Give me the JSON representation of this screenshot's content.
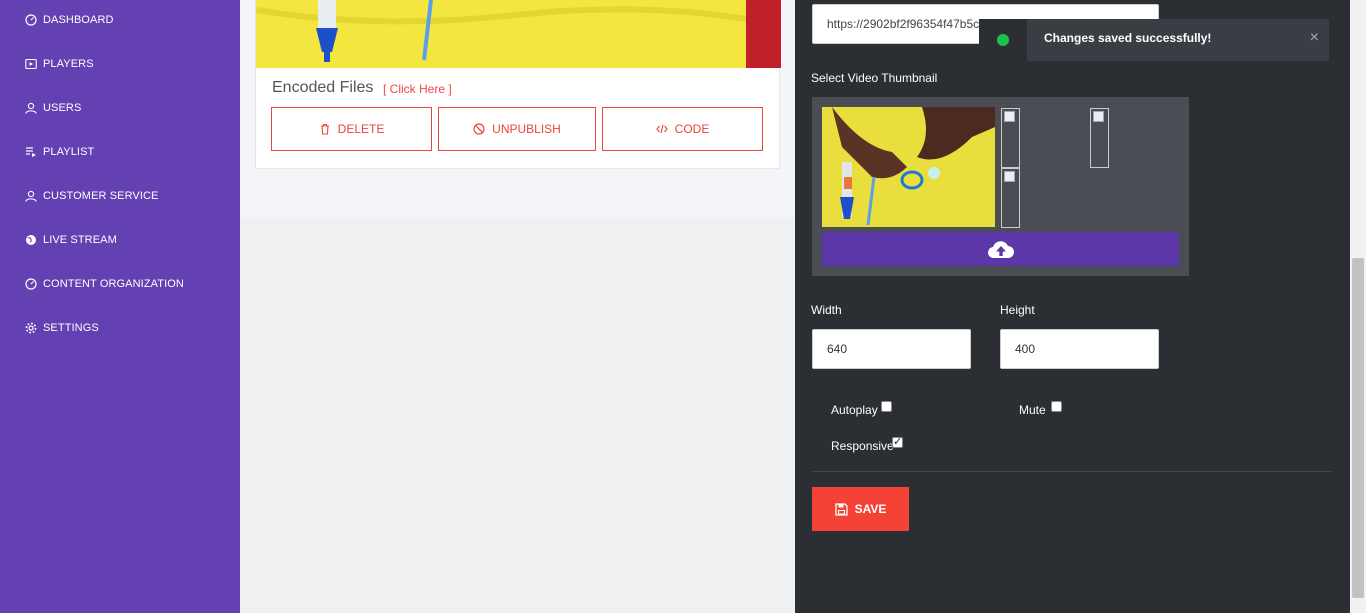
{
  "sidebar": {
    "items": [
      {
        "label": "DASHBOARD",
        "icon": "gauge-icon"
      },
      {
        "label": "PLAYERS",
        "icon": "play-icon"
      },
      {
        "label": "USERS",
        "icon": "user-icon"
      },
      {
        "label": "PLAYLIST",
        "icon": "playlist-icon"
      },
      {
        "label": "CUSTOMER SERVICE",
        "icon": "user-icon"
      },
      {
        "label": "LIVE STREAM",
        "icon": "globe-icon"
      },
      {
        "label": "CONTENT ORGANIZATION",
        "icon": "gauge-icon"
      },
      {
        "label": "SETTINGS",
        "icon": "gear-icon"
      }
    ]
  },
  "card": {
    "encoded_title": "Encoded Files",
    "click_here": "[ Click Here ]",
    "buttons": {
      "delete": "DELETE",
      "unpublish": "UNPUBLISH",
      "code": "CODE"
    }
  },
  "right": {
    "url_value": "https://2902bf2f96354f47b5c",
    "thumbnail_label": "Select Video Thumbnail",
    "width_label": "Width",
    "width_value": "640",
    "height_label": "Height",
    "height_value": "400",
    "autoplay_label": "Autoplay",
    "autoplay_checked": false,
    "mute_label": "Mute",
    "mute_checked": false,
    "responsive_label": "Responsive",
    "responsive_checked": true,
    "save_label": "SAVE"
  },
  "toast": {
    "message": "Changes saved successfully!",
    "close": "×"
  },
  "colors": {
    "sidebar": "#6441b2",
    "accent_red": "#f44336",
    "toast_green": "#1cc24a",
    "upload_purple": "#5b37a7",
    "panel_dark": "#2b2e33"
  }
}
